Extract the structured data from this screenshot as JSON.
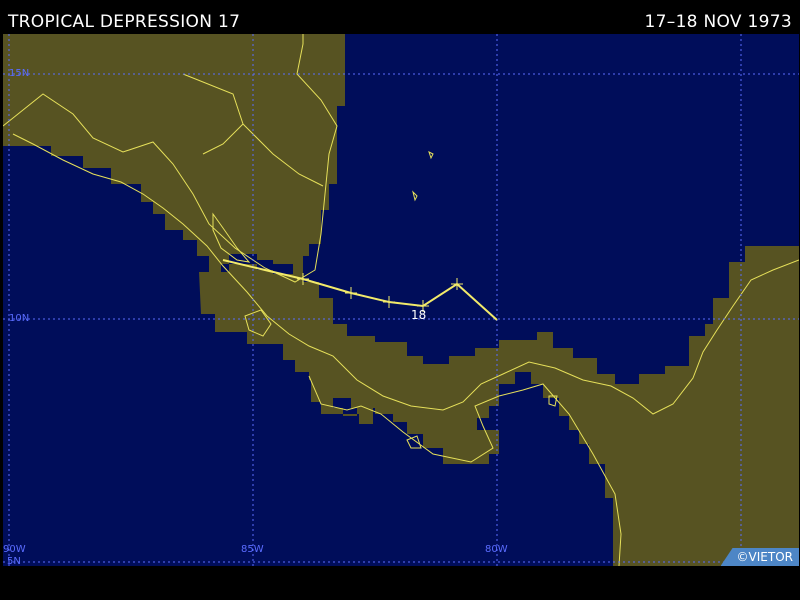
{
  "header": {
    "storm_name": "TROPICAL DEPRESSION 17",
    "date_range": "17–18 NOV 1973"
  },
  "map": {
    "lat_labels": [
      "15N",
      "10N",
      "5N"
    ],
    "lon_labels": [
      "90W",
      "85W",
      "80W"
    ],
    "track_day_label": "18",
    "colors": {
      "ocean": "#000d5a",
      "land": "#575322",
      "coastline": "#e6e05a",
      "track": "#f2ea6a",
      "grid": "#5a6cff"
    },
    "copyright": "©VIETOR"
  }
}
